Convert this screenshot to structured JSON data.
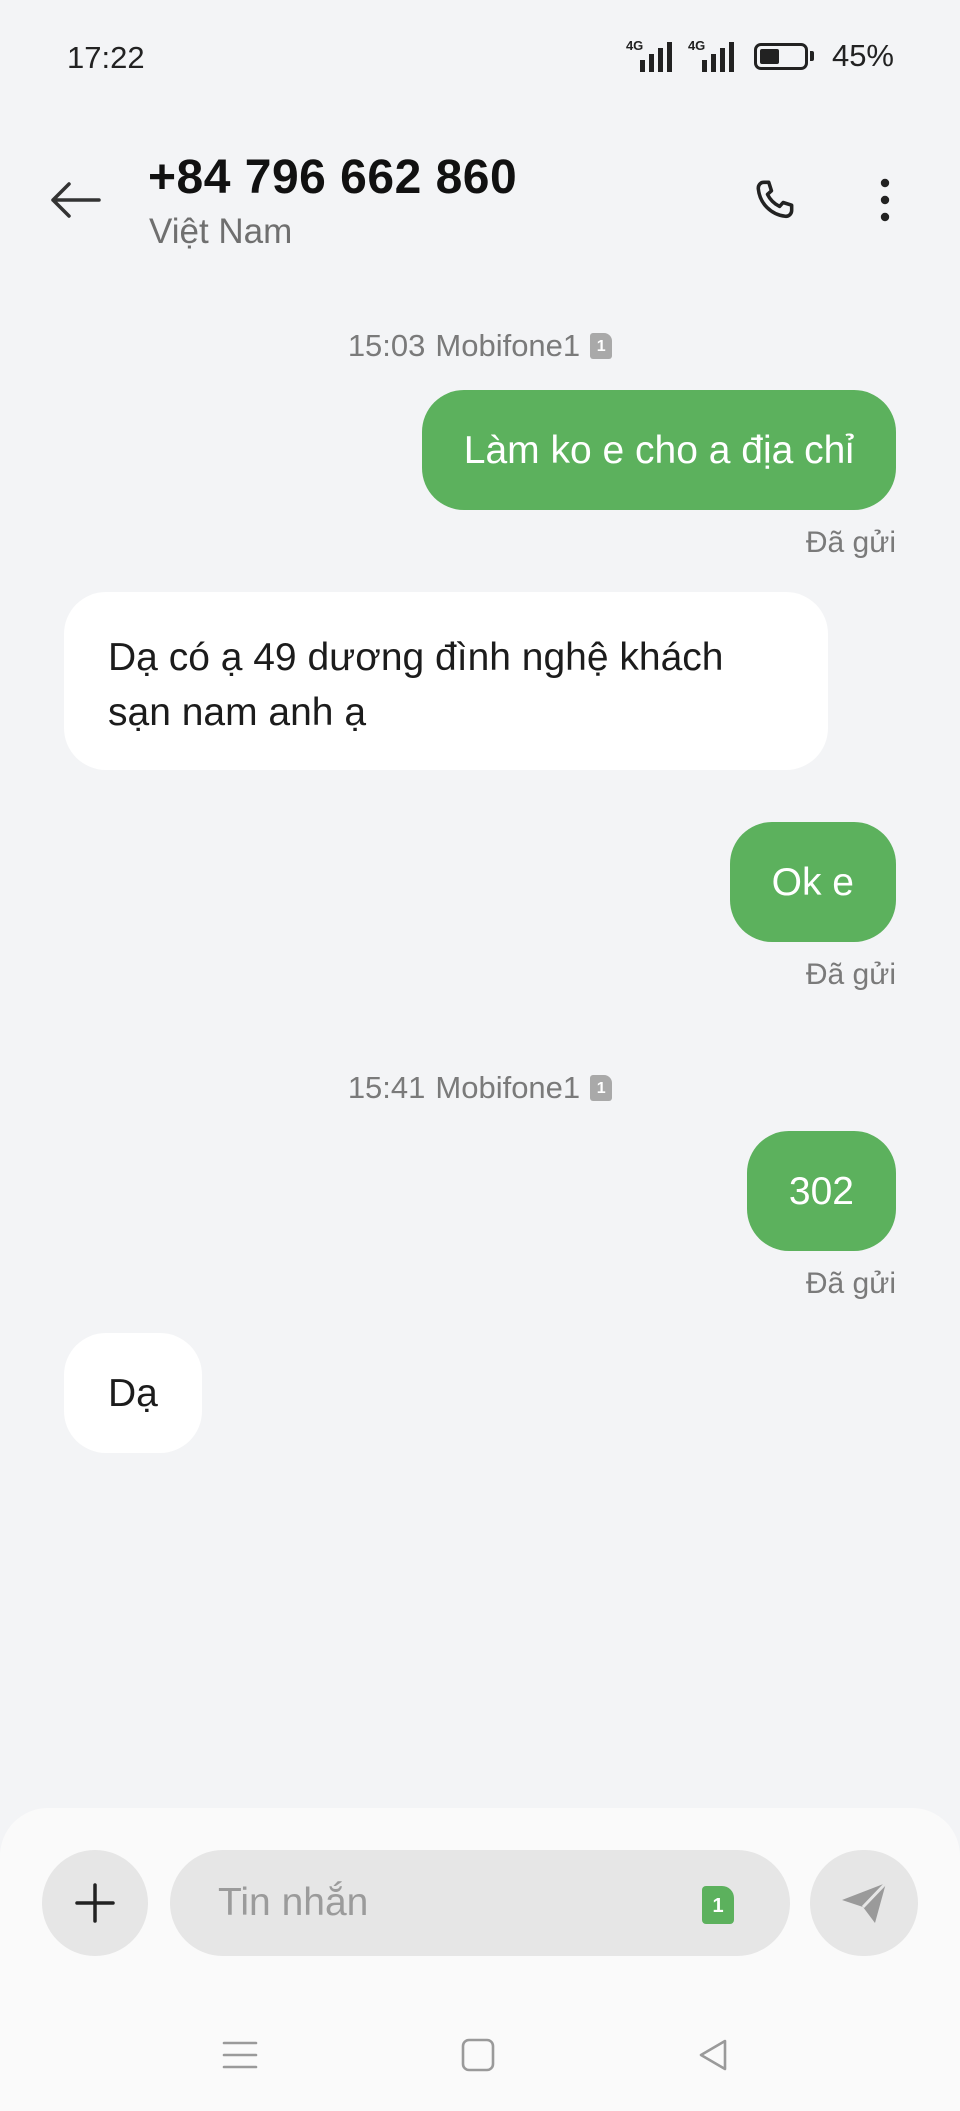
{
  "status_bar": {
    "time": "17:22",
    "network_1": "4G",
    "network_2": "4G",
    "battery_percent": "45%",
    "battery_level": 0.45
  },
  "header": {
    "contact_name": "+84 796 662 860",
    "contact_subtitle": "Việt Nam",
    "back_icon": "arrow-left-icon",
    "call_icon": "phone-icon",
    "more_icon": "more-vertical-icon"
  },
  "conversation": {
    "groups": [
      {
        "time": "15:03",
        "sim": "Mobifone1",
        "sim_slot": "1"
      },
      {
        "time": "15:41",
        "sim": "Mobifone1",
        "sim_slot": "1"
      }
    ],
    "messages": [
      {
        "direction": "out",
        "text": "Làm ko e cho a địa chỉ",
        "status": "Đã gửi"
      },
      {
        "direction": "in",
        "text": "Dạ có ạ 49 dương đình nghệ khách sạn nam anh ạ"
      },
      {
        "direction": "out",
        "text": "Ok e",
        "status": "Đã gửi"
      },
      {
        "direction": "out",
        "text": "302",
        "status": "Đã gửi"
      },
      {
        "direction": "in",
        "text": "Dạ"
      }
    ]
  },
  "composer": {
    "placeholder": "Tin nhắn",
    "sim_slot": "1",
    "add_icon": "plus-icon",
    "send_icon": "send-icon"
  },
  "navbar": {
    "icons": [
      "menu-icon",
      "home-square-icon",
      "back-triangle-icon"
    ]
  },
  "colors": {
    "outgoing_bubble": "#5cb15d",
    "background": "#f3f4f6",
    "incoming_bubble": "#ffffff"
  }
}
